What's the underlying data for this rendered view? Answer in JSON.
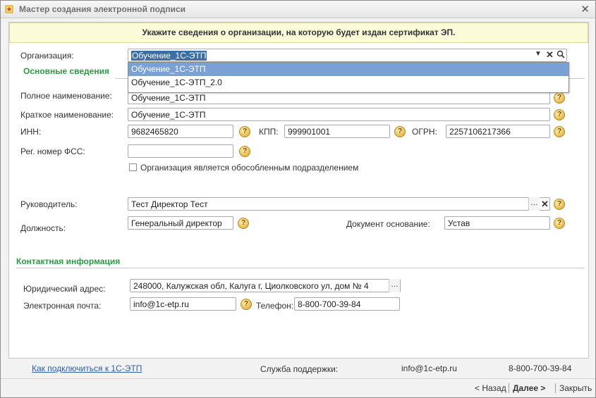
{
  "window": {
    "title": "Мастер создания электронной подписи"
  },
  "banner": "Укажите сведения о организации, на которую будет издан сертификат ЭП.",
  "org": {
    "label": "Организация:",
    "value": "Обучение_1С-ЭТП",
    "dropdown": [
      "Обучение_1С-ЭТП",
      "Обучение_1С-ЭТП_2.0"
    ]
  },
  "sections": {
    "basic": "Основные сведения",
    "contact": "Контактная информация"
  },
  "fields": {
    "full_name_label": "Полное наименование:",
    "full_name": "Обучение_1С-ЭТП",
    "short_name_label": "Краткое наименование:",
    "short_name": "Обучение_1С-ЭТП",
    "inn_label": "ИНН:",
    "inn": "9682465820",
    "kpp_label": "КПП:",
    "kpp": "999901001",
    "ogrn_label": "ОГРН:",
    "ogrn": "2257106217366",
    "fss_label": "Рег. номер ФСС:",
    "fss": "",
    "separate_division_label": "Организация является обособленным подразделением",
    "manager_label": "Руководитель:",
    "manager": "Тест Директор Тест",
    "position_label": "Должность:",
    "position": "Генеральный директор",
    "basis_label": "Документ основание:",
    "basis": "Устав"
  },
  "contact": {
    "address_label": "Юридический адрес:",
    "address": "248000, Калужская обл, Калуга г, Циолковского ул, дом № 4",
    "email_label": "Электронная почта:",
    "email": "info@1c-etp.ru",
    "phone_label": "Телефон:",
    "phone": "8-800-700-39-84"
  },
  "footer": {
    "link": "Как подключиться к 1С-ЭТП",
    "support_label": "Служба поддержки:",
    "support_email": "info@1c-etp.ru",
    "support_phone": "8-800-700-39-84"
  },
  "nav": {
    "back": "< Назад",
    "next": "Далее >",
    "close": "Закрыть"
  },
  "icons": {
    "help": "question-circle-icon",
    "clear": "close-icon",
    "search": "search-icon",
    "dropdown": "chevron-down-icon",
    "select": "ellipsis-icon"
  }
}
